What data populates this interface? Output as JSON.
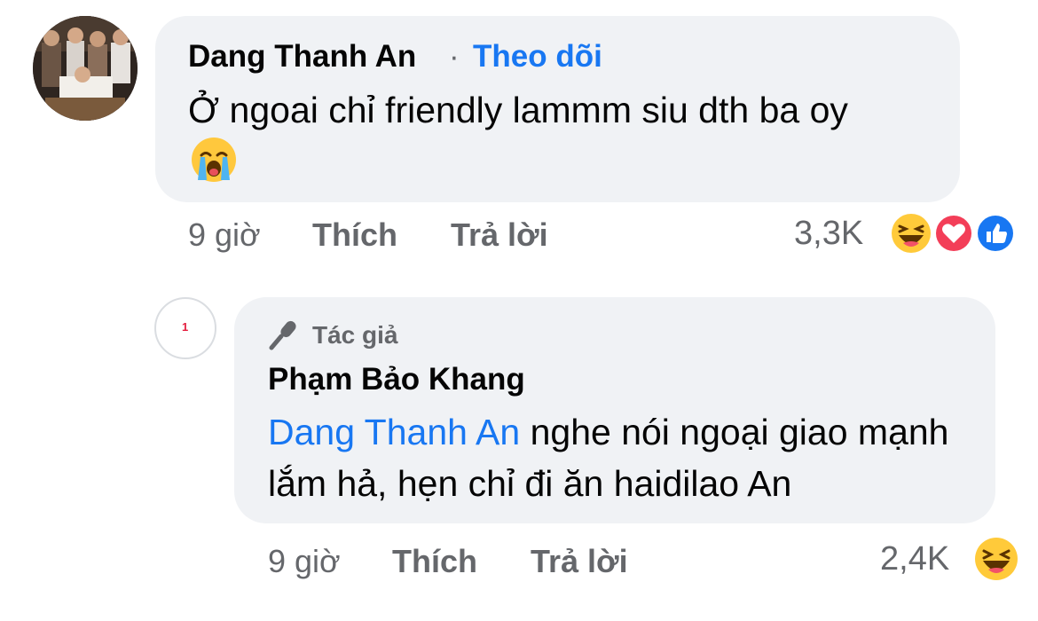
{
  "comment1": {
    "author": "Dang Thanh An",
    "separator": "·",
    "follow_label": "Theo dõi",
    "text": "Ở ngoai chỉ friendly lammm siu dth ba oy",
    "emoji": "loudly-crying-face-icon",
    "time": "9 giờ",
    "like_label": "Thích",
    "reply_label": "Trả lời",
    "reaction_count": "3,3K",
    "reactions": [
      "haha-icon",
      "love-icon",
      "like-icon"
    ]
  },
  "comment2": {
    "badge_icon": "microphone-icon",
    "badge_label": "Tác giả",
    "author": "Phạm Bảo Khang",
    "mention": "Dang Thanh An",
    "text": " nghe nói ngoại giao mạnh lắm hả, hẹn chỉ đi ăn haidilao An",
    "avatar_label": "1",
    "time": "9 giờ",
    "like_label": "Thích",
    "reply_label": "Trả lời",
    "reaction_count": "2,4K",
    "reactions": [
      "haha-icon"
    ]
  },
  "colors": {
    "bubble": "#f0f2f5",
    "link_blue": "#1877f2",
    "secondary_text": "#65676b"
  }
}
